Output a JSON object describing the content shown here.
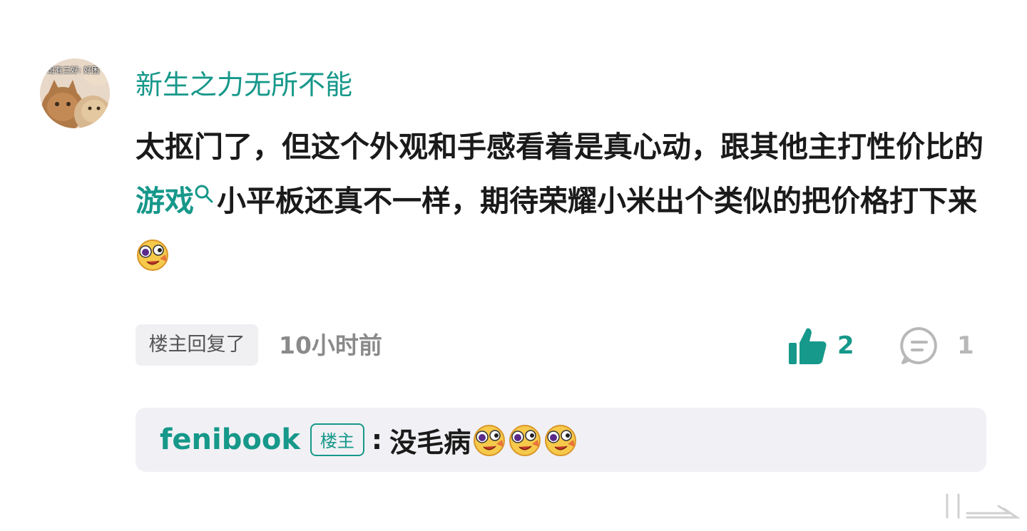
{
  "user": {
    "name": "新生之力无所不能",
    "avatar_caption": "班有三好: 好困"
  },
  "comment": {
    "text_before_link": "太抠门了，但这个外观和手感看着是真心动，跟其他主打性价比的",
    "link_text": "游戏",
    "text_after_link": "小平板还真不一样，期待荣耀小米出个类似的把价格打下来"
  },
  "meta": {
    "op_replied_label": "楼主回复了",
    "time_ago": "10小时前"
  },
  "actions": {
    "like_count": "2",
    "comment_count": "1"
  },
  "reply": {
    "author": "fenibook",
    "author_tag": "楼主",
    "separator": ":",
    "text": "没毛病"
  },
  "colors": {
    "accent": "#16988a",
    "text": "#1a1a1a",
    "muted": "#8a8a8a",
    "reply_bg": "#f1f1f5"
  },
  "icons": {
    "like": "thumbs-up-icon",
    "comment": "comment-bubble-icon",
    "search": "search-icon",
    "emoji": "silly-face-emoji-icon"
  }
}
